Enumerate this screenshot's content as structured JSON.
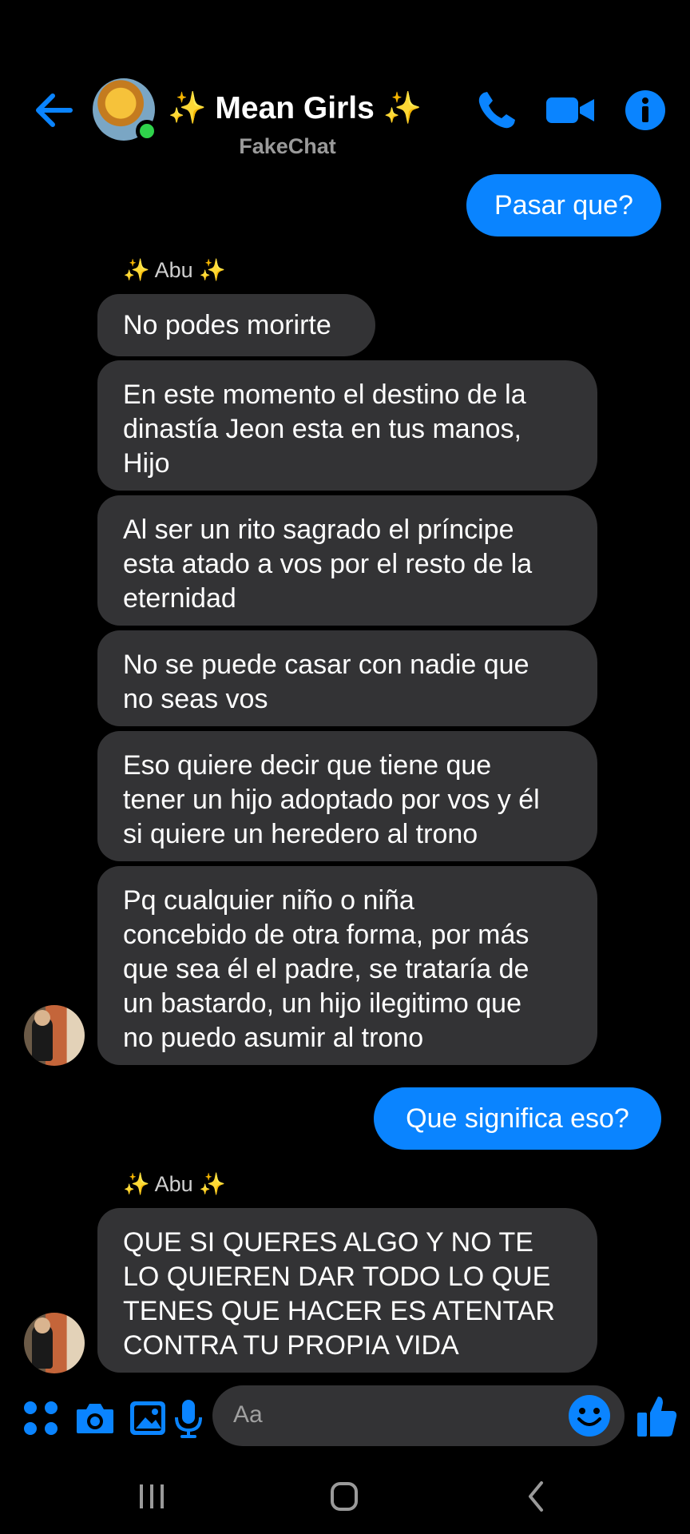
{
  "header": {
    "title": "✨ Mean Girls ✨",
    "subtitle": "FakeChat",
    "back_icon": "arrow-left-icon",
    "call_icon": "phone-icon",
    "video_icon": "video-camera-icon",
    "info_icon": "info-icon"
  },
  "messages": [
    {
      "id": "m1",
      "direction": "outgoing",
      "text": "Pasar que?"
    },
    {
      "id": "s1",
      "type": "sender",
      "text": "✨ Abu ✨"
    },
    {
      "id": "m2",
      "direction": "incoming",
      "text": "No podes morirte"
    },
    {
      "id": "m3",
      "direction": "incoming",
      "lines": [
        "En este momento el destino de la",
        "dinastía Jeon esta en tus manos,",
        "Hijo"
      ]
    },
    {
      "id": "m4",
      "direction": "incoming",
      "lines": [
        "Al ser un rito sagrado el príncipe",
        "esta atado a vos por el resto de la",
        "eternidad"
      ]
    },
    {
      "id": "m5",
      "direction": "incoming",
      "lines": [
        "No se puede casar con nadie que",
        "no seas vos"
      ]
    },
    {
      "id": "m6",
      "direction": "incoming",
      "lines": [
        "Eso quiere decir que tiene que",
        "tener un hijo adoptado por vos y él",
        "si quiere un heredero al trono"
      ]
    },
    {
      "id": "m7",
      "direction": "incoming",
      "lines": [
        "Pq cualquier niño o niña",
        "concebido de otra forma, por más",
        "que sea él el padre, se trataría de",
        "un bastardo, un hijo ilegitimo que",
        "no puedo asumir al trono"
      ]
    },
    {
      "id": "m8",
      "direction": "outgoing",
      "text": "Que significa eso?"
    },
    {
      "id": "s2",
      "type": "sender",
      "text": "✨ Abu ✨"
    },
    {
      "id": "m9",
      "direction": "incoming",
      "lines": [
        "QUE SI QUERES ALGO Y NO TE",
        "LO QUIEREN DAR TODO LO QUE",
        "TENES QUE HACER ES ATENTAR",
        "CONTRA TU PROPIA VIDA"
      ]
    }
  ],
  "composer": {
    "placeholder": "Aa",
    "apps_icon": "four-dots-icon",
    "camera_icon": "camera-icon",
    "gallery_icon": "image-icon",
    "mic_icon": "microphone-icon",
    "emoji_icon": "smiley-icon",
    "like_icon": "thumbs-up-icon"
  },
  "colors": {
    "accent": "#0a84ff",
    "incoming_bubble": "#333335",
    "background": "#000000",
    "online": "#2fd34b"
  }
}
